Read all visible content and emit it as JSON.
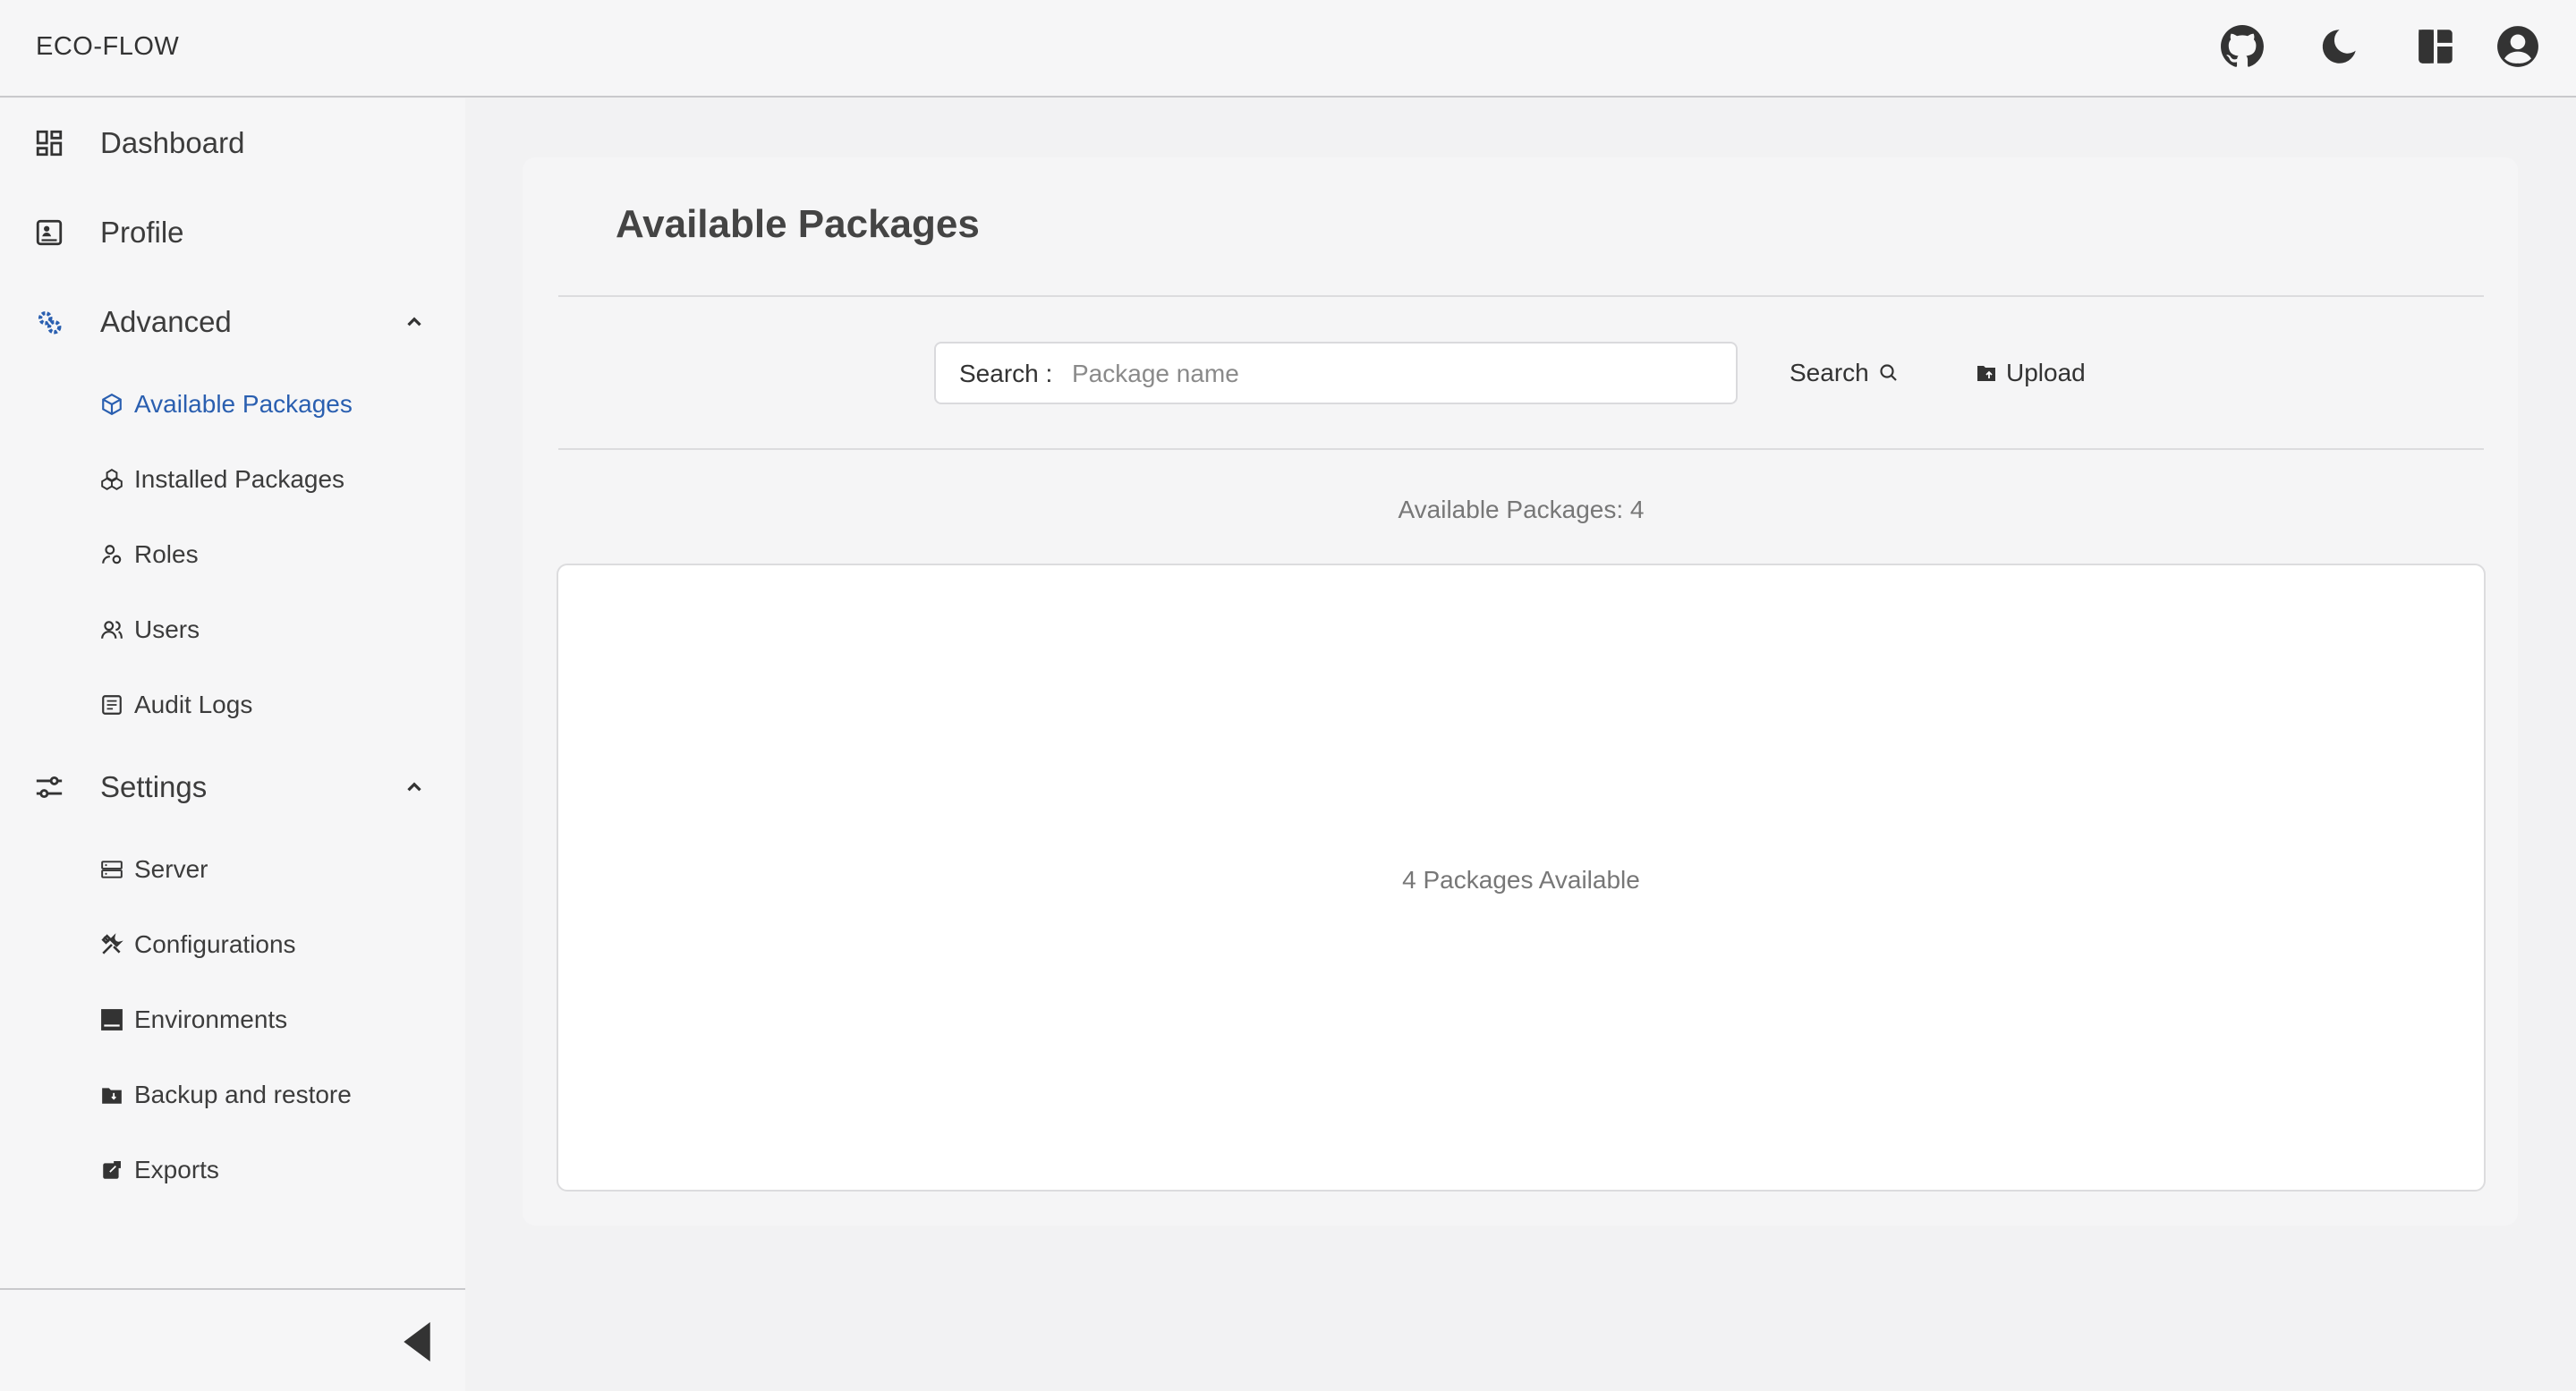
{
  "header": {
    "app_title": "ECO-FLOW",
    "icons": [
      "github-icon",
      "dark-mode-icon",
      "layout-icon",
      "account-icon"
    ]
  },
  "sidebar": {
    "items": [
      {
        "label": "Dashboard",
        "icon": "dashboard-icon"
      },
      {
        "label": "Profile",
        "icon": "profile-icon"
      },
      {
        "label": "Advanced",
        "icon": "advanced-icon",
        "expanded": true,
        "children": [
          {
            "label": "Available Packages",
            "icon": "package-icon",
            "active": true
          },
          {
            "label": "Installed Packages",
            "icon": "installed-packages-icon"
          },
          {
            "label": "Roles",
            "icon": "roles-icon"
          },
          {
            "label": "Users",
            "icon": "users-icon"
          },
          {
            "label": "Audit Logs",
            "icon": "audit-logs-icon"
          }
        ]
      },
      {
        "label": "Settings",
        "icon": "settings-icon",
        "expanded": true,
        "children": [
          {
            "label": "Server",
            "icon": "server-icon"
          },
          {
            "label": "Configurations",
            "icon": "configurations-icon"
          },
          {
            "label": "Environments",
            "icon": "environments-icon"
          },
          {
            "label": "Backup and restore",
            "icon": "backup-icon"
          },
          {
            "label": "Exports",
            "icon": "exports-icon"
          }
        ]
      }
    ]
  },
  "main": {
    "title": "Available Packages",
    "search": {
      "label": "Search :",
      "placeholder": "Package name",
      "value": "",
      "button_label": "Search",
      "upload_label": "Upload"
    },
    "count_text": "Available Packages: 4",
    "panel_text": "4 Packages Available"
  },
  "colors": {
    "accent": "#2a5fb0",
    "background": "#f2f2f3",
    "sidebar": "#f6f6f7"
  }
}
